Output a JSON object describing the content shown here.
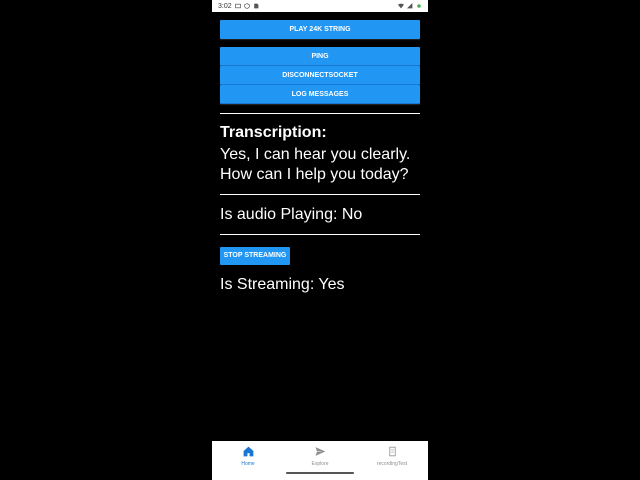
{
  "status_bar": {
    "time": "3:02"
  },
  "buttons": {
    "play": "PLAY 24K STRING",
    "ping": "PING",
    "disconnect": "DISCONNECTSOCKET",
    "log": "LOG MESSAGES",
    "stop_streaming": "STOP STREAMING"
  },
  "transcription": {
    "title": "Transcription:",
    "text": "Yes, I can hear you clearly. How can I help you today?"
  },
  "audio_status": "Is audio Playing: No",
  "streaming_status": "Is Streaming: Yes",
  "tabs": [
    {
      "label": "Home",
      "icon": "home-icon",
      "active": true
    },
    {
      "label": "Explore",
      "icon": "send-icon",
      "active": false
    },
    {
      "label": "recordingTest",
      "icon": "document-icon",
      "active": false
    }
  ],
  "colors": {
    "accent": "#2196f3",
    "active_tab": "#1976d2",
    "inactive_tab": "#8e8e93",
    "background": "#000000"
  }
}
